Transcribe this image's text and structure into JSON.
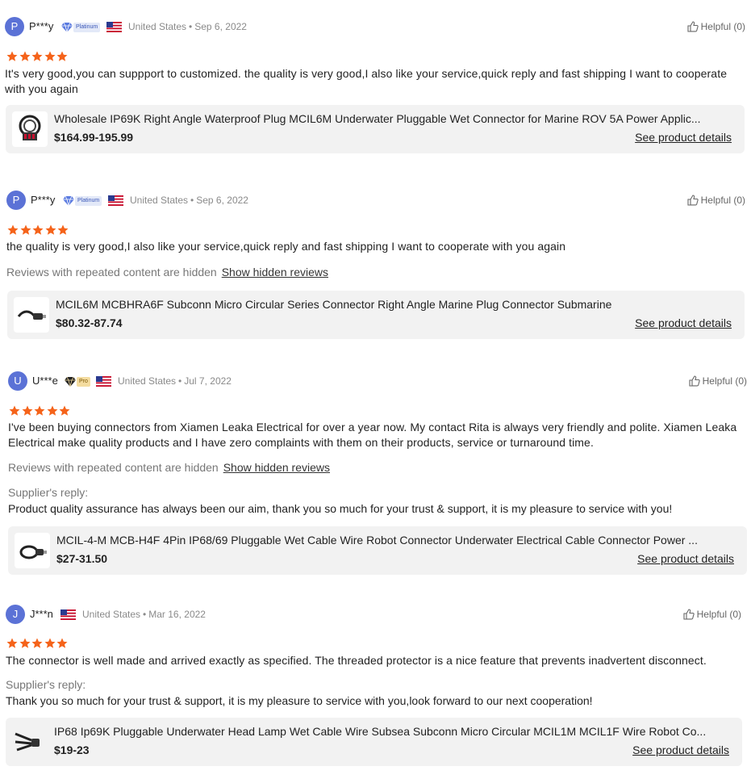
{
  "helpful_label": "Helpful (0)",
  "show_hidden_label": "Show hidden reviews",
  "hidden_note": "Reviews with repeated content are hidden",
  "see_details_label": "See product details",
  "supplier_reply_label": "Supplier's reply:",
  "star_color": "#f5631a",
  "reviews": [
    {
      "initial": "P",
      "name": "P***y",
      "badge": "Platinum",
      "country": "United States",
      "date": "Sep 6, 2022",
      "rating": 5,
      "text": "It's very good,you can suppport to customized. the quality is very good,I also like your service,quick reply and fast shipping I want to cooperate with you again",
      "product": {
        "title": "Wholesale IP69K Right Angle Waterproof Plug MCIL6M Underwater Pluggable Wet Connector for Marine ROV 5A Power Applic...",
        "price": "$164.99-195.99",
        "thumb_icon": "connector-coil-icon"
      }
    },
    {
      "initial": "P",
      "name": "P***y",
      "badge": "Platinum",
      "country": "United States",
      "date": "Sep 6, 2022",
      "rating": 5,
      "text": "the quality is very good,I also like your service,quick reply and fast shipping I want to cooperate with you again",
      "product": {
        "title": "MCIL6M MCBHRA6F Subconn Micro Circular Series Connector Right Angle Marine Plug Connector Submarine",
        "price": "$80.32-87.74",
        "thumb_icon": "cable-plug-icon"
      }
    },
    {
      "initial": "U",
      "name": "U***e",
      "badge": "Pro",
      "country": "United States",
      "date": "Jul 7, 2022",
      "rating": 5,
      "text": "I've been buying connectors from Xiamen Leaka Electrical for over a year now. My contact Rita is always very friendly and polite. Xiamen Leaka Electrical make quality products and I have zero complaints with them on their products, service or turnaround time.",
      "supplier_reply": "Product quality assurance has always been our aim,  thank you so much for your trust & support, it is my pleasure to service with you!",
      "product": {
        "title": "MCIL-4-M MCB-H4F 4Pin IP68/69 Pluggable Wet Cable Wire Robot Connector Underwater Electrical Cable Connector Power ...",
        "price": "$27-31.50",
        "thumb_icon": "cable-loop-icon"
      }
    },
    {
      "initial": "J",
      "name": "J***n",
      "country": "United States",
      "date": "Mar 16, 2022",
      "rating": 5,
      "text": "The connector is well made and arrived exactly as specified. The threaded protector is a nice feature that prevents inadvertent disconnect.",
      "supplier_reply": "Thank you so much for your trust & support, it is my pleasure to service with you,look forward to our next cooperation!",
      "product": {
        "title": "IP68 Ip69K Pluggable Underwater Head Lamp Wet Cable Wire Subsea Subconn Micro Circular MCIL1M MCIL1F Wire Robot Co...",
        "price": "$19-23",
        "thumb_icon": "cable-bundle-icon"
      }
    }
  ]
}
